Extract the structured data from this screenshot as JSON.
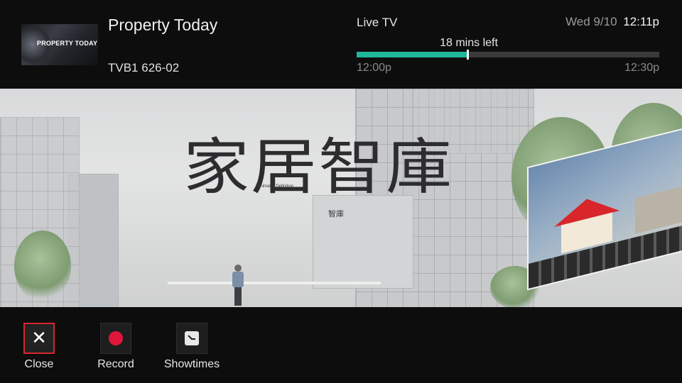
{
  "header": {
    "thumbnail_text": "PROPERTY TODAY",
    "show_title": "Property Today",
    "channel": "TVB1 626-02",
    "source_label": "Live TV",
    "date": "Wed 9/10",
    "time": "12:11p",
    "remaining": "18 mins left",
    "start_time": "12:00p",
    "end_time": "12:30p",
    "progress_fraction": 0.367
  },
  "video": {
    "logo_text": "家居智庫",
    "logo_subtitle": "Minimalist Definition",
    "logo_small": "智庫"
  },
  "actions": [
    {
      "label": "Close",
      "icon": "close-icon",
      "focused": true
    },
    {
      "label": "Record",
      "icon": "record-icon",
      "focused": false
    },
    {
      "label": "Showtimes",
      "icon": "clock-icon",
      "focused": false
    }
  ],
  "colors": {
    "progress": "#1fb89a",
    "focus_border": "#d8262f",
    "record": "#e0163a"
  }
}
